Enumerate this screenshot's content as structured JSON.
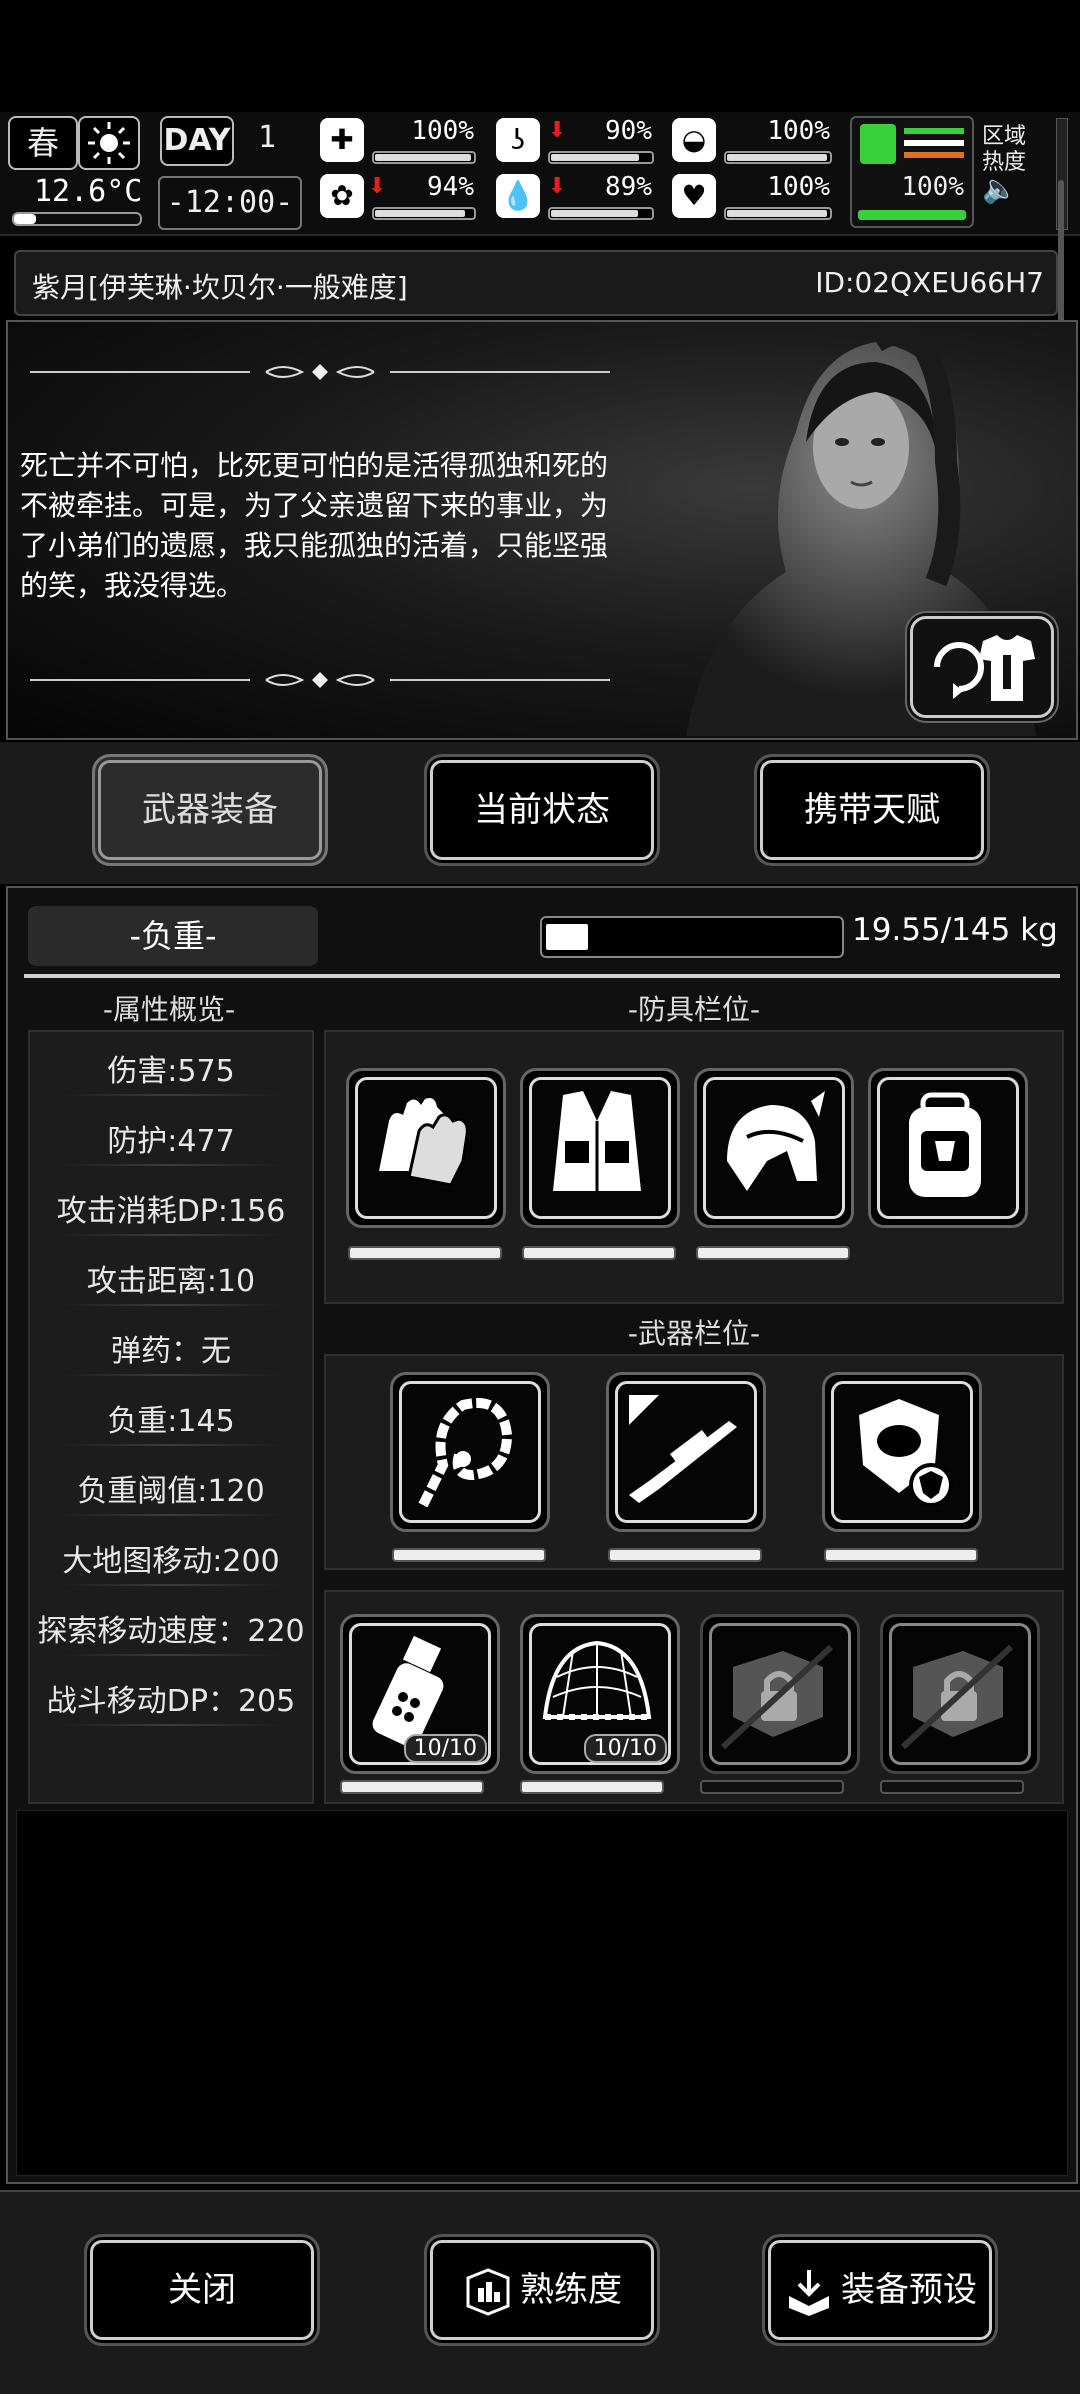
{
  "hud": {
    "season": "春",
    "day_label": "DAY",
    "day_number": "1",
    "temperature": "12.6°C",
    "time": "-12:00-",
    "stats": [
      {
        "name": "health",
        "value": "100%",
        "level": 1.0,
        "down": false
      },
      {
        "name": "stomach",
        "value": "90%",
        "level": 0.9,
        "down": true
      },
      {
        "name": "armor",
        "value": "100%",
        "level": 1.0,
        "down": false
      },
      {
        "name": "mind",
        "value": "94%",
        "level": 0.94,
        "down": true
      },
      {
        "name": "water",
        "value": "89%",
        "level": 0.89,
        "down": true
      },
      {
        "name": "heart",
        "value": "100%",
        "level": 1.0,
        "down": false
      }
    ],
    "stamina": "100%",
    "area_heat_label_1": "区域",
    "area_heat_label_2": "热度"
  },
  "character": {
    "name": "紫月[伊芙琳·坎贝尔·一般难度]",
    "id": "ID:02QXEU66H7",
    "quote": "死亡并不可怕，比死更可怕的是活得孤独和死的不被牵挂。可是，为了父亲遗留下来的事业，为了小弟们的遗愿，我只能孤独的活着，只能坚强的笑，我没得选。"
  },
  "tabs": [
    "武器装备",
    "当前状态",
    "携带天赋"
  ],
  "load": {
    "label": "-负重-",
    "text": "19.55/145 kg",
    "level": 0.135
  },
  "attributes": {
    "header": "-属性概览-",
    "items": [
      "伤害:575",
      "防护:477",
      "攻击消耗DP:156",
      "攻击距离:10",
      "弹药：无",
      "负重:145",
      "负重阈值:120",
      "大地图移动:200",
      "探索移动速度：220",
      "战斗移动DP：205"
    ]
  },
  "armor_header": "-防具栏位-",
  "weapon_header": "-武器栏位-",
  "armor_slots": [
    "gloves-icon",
    "vest-icon",
    "helmet-icon",
    "backpack-icon"
  ],
  "weapon_slots": [
    "whip-icon",
    "sniper-rifle-icon",
    "shield-icon"
  ],
  "item_slots": [
    {
      "icon": "grenade-icon",
      "count": "10/10"
    },
    {
      "icon": "net-icon",
      "count": "10/10"
    },
    {
      "icon": "locked-slot-icon",
      "count": ""
    },
    {
      "icon": "locked-slot-icon",
      "count": ""
    }
  ],
  "bottom_buttons": {
    "close": "关闭",
    "proficiency": "熟练度",
    "preset": "装备预设"
  }
}
